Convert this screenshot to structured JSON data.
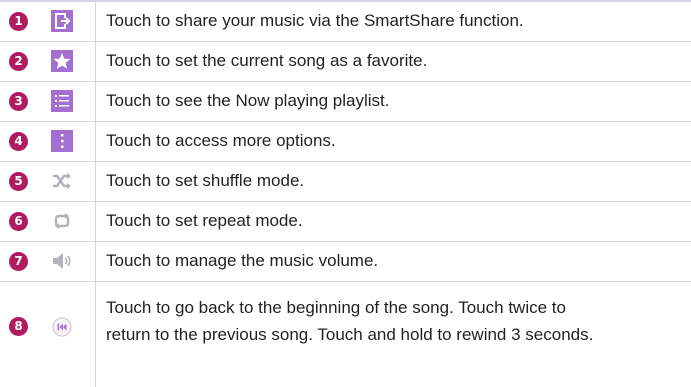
{
  "rows": [
    {
      "number": "1",
      "icon": "share-icon",
      "text": "Touch to share your music via the SmartShare function."
    },
    {
      "number": "2",
      "icon": "star-icon",
      "text": "Touch to set the current song as a favorite."
    },
    {
      "number": "3",
      "icon": "playlist-icon",
      "text": "Touch to see the Now playing playlist."
    },
    {
      "number": "4",
      "icon": "more-options-icon",
      "text": "Touch to access more options."
    },
    {
      "number": "5",
      "icon": "shuffle-icon",
      "text": "Touch to set shuffle mode."
    },
    {
      "number": "6",
      "icon": "repeat-icon",
      "text": "Touch to set repeat mode."
    },
    {
      "number": "7",
      "icon": "volume-icon",
      "text": "Touch to manage the music volume."
    },
    {
      "number": "8",
      "icon": "rewind-icon",
      "text_line1": "Touch to go back to the beginning of the song. Touch twice to",
      "text_line2": "return to the previous song. Touch and hold to rewind 3 seconds."
    }
  ],
  "colors": {
    "number_badge": "#b01a5e",
    "icon_box": "#a36fd0",
    "icon_plain": "#b5b1b8",
    "divider": "#d8d8d8",
    "text": "#231f20"
  }
}
